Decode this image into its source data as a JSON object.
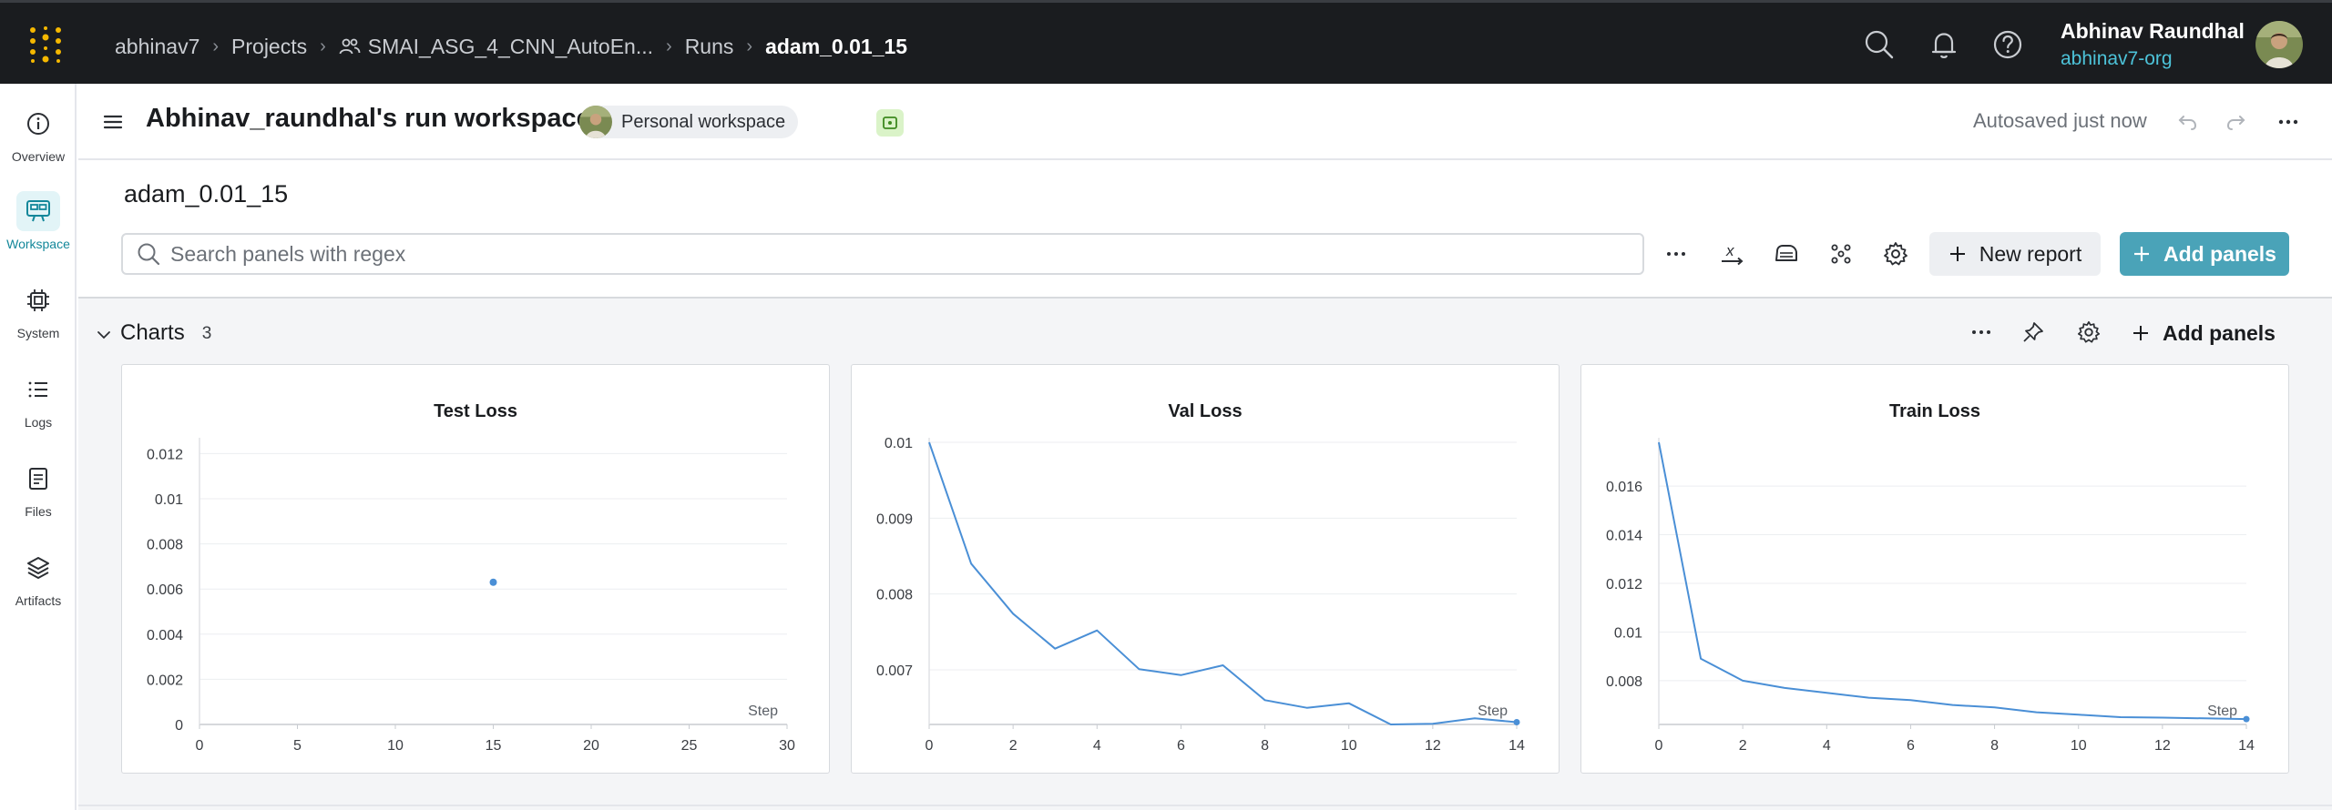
{
  "topbar": {
    "breadcrumb": [
      "abhinav7",
      "Projects",
      "SMAI_ASG_4_CNN_AutoEn...",
      "Runs",
      "adam_0.01_15"
    ],
    "user_name": "Abhinav Raundhal",
    "user_org": "abhinav7-org",
    "icons": [
      "search-icon",
      "bell-icon",
      "help-icon"
    ]
  },
  "rail": {
    "items": [
      {
        "label": "Overview",
        "icon": "info-icon"
      },
      {
        "label": "Workspace",
        "icon": "workspace-icon",
        "active": true
      },
      {
        "label": "System",
        "icon": "chip-icon"
      },
      {
        "label": "Logs",
        "icon": "list-icon"
      },
      {
        "label": "Files",
        "icon": "file-icon"
      },
      {
        "label": "Artifacts",
        "icon": "layers-icon"
      }
    ]
  },
  "workspace": {
    "title": "Abhinav_raundhal's run workspace",
    "badge": "Personal workspace",
    "autosaved": "Autosaved just now"
  },
  "run": {
    "name": "adam_0.01_15",
    "search_placeholder": "Search panels with regex",
    "new_report_label": "New report",
    "add_panels_label": "Add panels"
  },
  "section": {
    "title": "Charts",
    "count": "3",
    "add_panels_label": "Add panels"
  },
  "colors": {
    "accent": "#4aa3b8",
    "series": "#4a8fd6",
    "topbar": "#1a1c1f"
  },
  "chart_data": [
    {
      "type": "scatter",
      "title": "Test Loss",
      "xlabel": "Step",
      "ylabel": "",
      "xlim": [
        0,
        30
      ],
      "ylim": [
        0,
        0.0125
      ],
      "xticks": [
        0,
        5,
        10,
        15,
        20,
        25,
        30
      ],
      "xtick_labels": [
        "0",
        "5",
        "10",
        "15",
        "20",
        "25",
        "30"
      ],
      "yticks": [
        0,
        0.002,
        0.004,
        0.006,
        0.008,
        0.01,
        0.012
      ],
      "ytick_labels": [
        "0",
        "0.002",
        "0.004",
        "0.006",
        "0.008",
        "0.01",
        "0.012"
      ],
      "series": [
        {
          "x": [
            15
          ],
          "values": [
            0.0063
          ]
        }
      ]
    },
    {
      "type": "line",
      "title": "Val Loss",
      "xlabel": "Step",
      "ylabel": "",
      "xlim": [
        0,
        14
      ],
      "ylim": [
        0.00628,
        0.01
      ],
      "xticks": [
        0,
        2,
        4,
        6,
        8,
        10,
        12,
        14
      ],
      "xtick_labels": [
        "0",
        "2",
        "4",
        "6",
        "8",
        "10",
        "12",
        "14"
      ],
      "yticks": [
        0.007,
        0.008,
        0.009,
        0.01
      ],
      "ytick_labels": [
        "0.007",
        "0.008",
        "0.009",
        "0.01"
      ],
      "series": [
        {
          "x": [
            0,
            1,
            2,
            3,
            4,
            5,
            6,
            7,
            8,
            9,
            10,
            11,
            12,
            13,
            14
          ],
          "values": [
            0.01,
            0.0084,
            0.00774,
            0.00728,
            0.00752,
            0.00701,
            0.00693,
            0.00706,
            0.0066,
            0.0065,
            0.00656,
            0.00628,
            0.00629,
            0.00636,
            0.00631
          ]
        }
      ]
    },
    {
      "type": "line",
      "title": "Train Loss",
      "xlabel": "Step",
      "ylabel": "",
      "xlim": [
        0,
        14
      ],
      "ylim": [
        0.0062,
        0.0178
      ],
      "xticks": [
        0,
        2,
        4,
        6,
        8,
        10,
        12,
        14
      ],
      "xtick_labels": [
        "0",
        "2",
        "4",
        "6",
        "8",
        "10",
        "12",
        "14"
      ],
      "yticks": [
        0.008,
        0.01,
        0.012,
        0.014,
        0.016
      ],
      "ytick_labels": [
        "0.008",
        "0.01",
        "0.012",
        "0.014",
        "0.016"
      ],
      "series": [
        {
          "x": [
            0,
            1,
            2,
            3,
            4,
            5,
            6,
            7,
            8,
            9,
            10,
            11,
            12,
            13,
            14
          ],
          "values": [
            0.0178,
            0.0089,
            0.008,
            0.0077,
            0.0075,
            0.0073,
            0.0072,
            0.007,
            0.0069,
            0.0067,
            0.0066,
            0.0065,
            0.00648,
            0.00645,
            0.00642
          ]
        }
      ]
    }
  ]
}
